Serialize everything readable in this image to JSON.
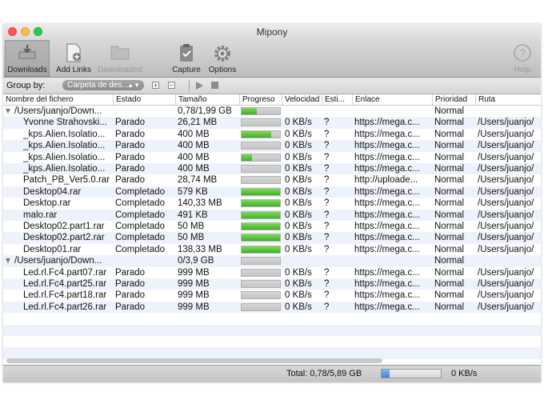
{
  "window": {
    "title": "Mipony"
  },
  "toolbar": {
    "downloads": "Downloads",
    "add_links": "Add Links",
    "downloaded": "Downloaded",
    "capture": "Capture",
    "options": "Options",
    "help": "Help"
  },
  "groupbar": {
    "label": "Group by:",
    "select_value": "Carpeta de des..."
  },
  "columns": [
    "Nombre del fichero",
    "Estado",
    "Tamaño",
    "Progreso",
    "Velocidad",
    "Esti...",
    "Enlace",
    "Prioridad",
    "Ruta"
  ],
  "rows": [
    {
      "type": "group",
      "name": "/Users/juanjo/Down...",
      "size": "0,78/1,99 GB",
      "progress": 0.39,
      "priority": "Normal"
    },
    {
      "name": "Yvonne Strahovski...",
      "status": "Parado",
      "size": "26,21 MB",
      "progress": 0.0,
      "speed": "0 KB/s",
      "eta": "?",
      "link": "https://mega.c...",
      "priority": "Normal",
      "path": "/Users/juanjo/"
    },
    {
      "name": "_kps.Alien.Isolatio...",
      "status": "Parado",
      "size": "400 MB",
      "progress": 0.78,
      "speed": "0 KB/s",
      "eta": "?",
      "link": "https://mega.c...",
      "priority": "Normal",
      "path": "/Users/juanjo/"
    },
    {
      "name": "_kps.Alien.Isolatio...",
      "status": "Parado",
      "size": "400 MB",
      "progress": 0.0,
      "speed": "0 KB/s",
      "eta": "?",
      "link": "https://mega.c...",
      "priority": "Normal",
      "path": "/Users/juanjo/"
    },
    {
      "name": "_kps.Alien.Isolatio...",
      "status": "Parado",
      "size": "400 MB",
      "progress": 0.28,
      "speed": "0 KB/s",
      "eta": "?",
      "link": "https://mega.c...",
      "priority": "Normal",
      "path": "/Users/juanjo/"
    },
    {
      "name": "_kps.Alien.Isolatio...",
      "status": "Parado",
      "size": "400 MB",
      "progress": 0.0,
      "speed": "0 KB/s",
      "eta": "?",
      "link": "https://mega.c...",
      "priority": "Normal",
      "path": "/Users/juanjo/"
    },
    {
      "name": "Patch_PB_Ver5.0.rar",
      "status": "Parado",
      "size": "28,74 MB",
      "progress": 0.0,
      "speed": "0 KB/s",
      "eta": "?",
      "link": "http://uploade...",
      "priority": "Normal",
      "path": "/Users/juanjo/"
    },
    {
      "name": "Desktop04.rar",
      "status": "Completado",
      "size": "579 KB",
      "progress": 1.0,
      "speed": "0 KB/s",
      "eta": "?",
      "link": "https://mega.c...",
      "priority": "Normal",
      "path": "/Users/juanjo/"
    },
    {
      "name": "Desktop.rar",
      "status": "Completado",
      "size": "140,33 MB",
      "progress": 1.0,
      "speed": "0 KB/s",
      "eta": "?",
      "link": "https://mega.c...",
      "priority": "Normal",
      "path": "/Users/juanjo/"
    },
    {
      "name": "malo.rar",
      "status": "Completado",
      "size": "491 KB",
      "progress": 1.0,
      "speed": "0 KB/s",
      "eta": "?",
      "link": "https://mega.c...",
      "priority": "Normal",
      "path": "/Users/juanjo/"
    },
    {
      "name": "Desktop02.part1.rar",
      "status": "Completado",
      "size": "50 MB",
      "progress": 1.0,
      "speed": "0 KB/s",
      "eta": "?",
      "link": "https://mega.c...",
      "priority": "Normal",
      "path": "/Users/juanjo/"
    },
    {
      "name": "Desktop02.part2.rar",
      "status": "Completado",
      "size": "50 MB",
      "progress": 1.0,
      "speed": "0 KB/s",
      "eta": "?",
      "link": "https://mega.c...",
      "priority": "Normal",
      "path": "/Users/juanjo/"
    },
    {
      "name": "Desktop01.rar",
      "status": "Completado",
      "size": "138,33 MB",
      "progress": 1.0,
      "speed": "0 KB/s",
      "eta": "?",
      "link": "https://mega.c...",
      "priority": "Normal",
      "path": "/Users/juanjo/"
    },
    {
      "type": "group",
      "name": "/Users/juanjo/Down...",
      "size": "0/3,9 GB",
      "progress": 0.0,
      "priority": "Normal"
    },
    {
      "name": "Led.rl.Fc4.part07.rar",
      "status": "Parado",
      "size": "999 MB",
      "progress": 0.0,
      "speed": "0 KB/s",
      "eta": "?",
      "link": "https://mega.c...",
      "priority": "Normal",
      "path": "/Users/juanjo/"
    },
    {
      "name": "Led.rl.Fc4.part25.rar",
      "status": "Parado",
      "size": "999 MB",
      "progress": 0.0,
      "speed": "0 KB/s",
      "eta": "?",
      "link": "https://mega.c...",
      "priority": "Normal",
      "path": "/Users/juanjo/"
    },
    {
      "name": "Led.rl.Fc4.part18.rar",
      "status": "Parado",
      "size": "999 MB",
      "progress": 0.0,
      "speed": "0 KB/s",
      "eta": "?",
      "link": "https://mega.c...",
      "priority": "Normal",
      "path": "/Users/juanjo/"
    },
    {
      "name": "Led.rl.Fc4.part26.rar",
      "status": "Parado",
      "size": "999 MB",
      "progress": 0.0,
      "speed": "0 KB/s",
      "eta": "?",
      "link": "https://mega.c...",
      "priority": "Normal",
      "path": "/Users/juanjo/"
    }
  ],
  "status": {
    "total": "Total: 0,78/5,89 GB",
    "progress": 0.13,
    "speed": "0 KB/s"
  },
  "colors": {
    "progress_green": "#4cbc32",
    "status_blue": "#4a90e2",
    "row_alt": "#eef3fb"
  }
}
